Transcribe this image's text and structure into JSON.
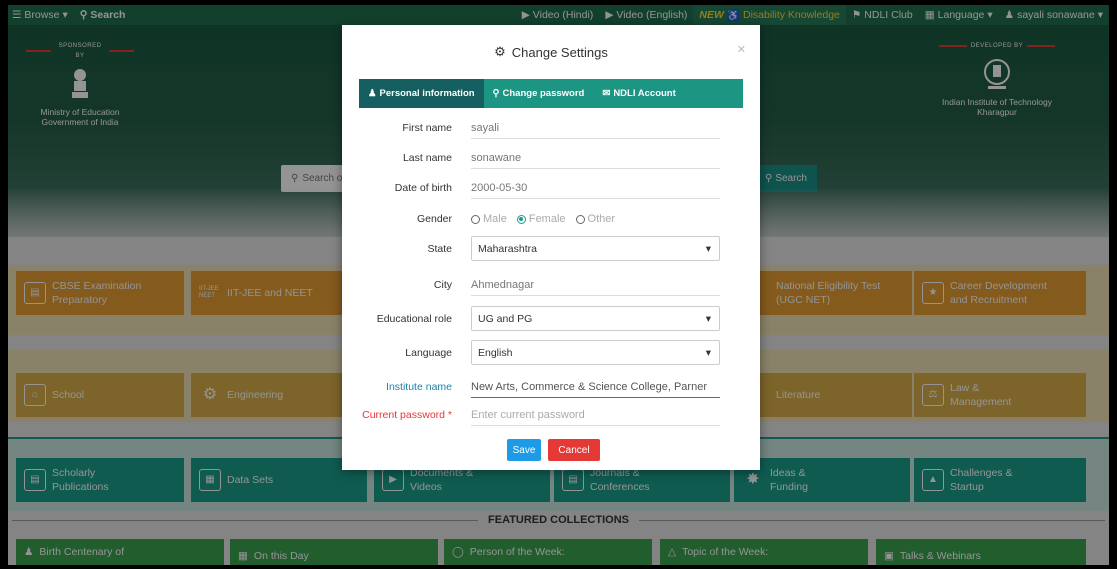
{
  "topbar": {
    "browse": "Browse",
    "search": "Search",
    "video_hindi": "Video (Hindi)",
    "video_english": "Video (English)",
    "new_badge": "NEW",
    "disability": "Disability Knowledge",
    "club": "NDLI Club",
    "language": "Language",
    "user": "sayali sonawane"
  },
  "hero": {
    "sponsor_caption": "SPONSORED BY",
    "sponsor_name": "Ministry of Education",
    "sponsor_sub": "Government of India",
    "developer_caption": "DEVELOPED BY",
    "developer_name": "Indian Institute of Technology",
    "developer_sub": "Kharagpur",
    "search_placeholder": "Search o",
    "search_button": "Search"
  },
  "tiles_row1": {
    "t1_line1": "CBSE Examination",
    "t1_line2": "Preparatory",
    "t2": "IIT-JEE and NEET",
    "t2_icon": "IIT-JEE NEET",
    "t3_line1": "National Eligibility Test",
    "t3_line2": "(UGC NET)",
    "t4_line1": "Career Development",
    "t4_line2": "and Recruitment"
  },
  "tiles_row2": {
    "t1": "School",
    "t2": "Engineering",
    "t3": "Literature",
    "t4_line1": "Law &",
    "t4_line2": "Management"
  },
  "tiles_row3": {
    "t1_line1": "Scholarly",
    "t1_line2": "Publications",
    "t2": "Data Sets",
    "t3_line1": "Documents &",
    "t3_line2": "Videos",
    "t4_line1": "Journals &",
    "t4_line2": "Conferences",
    "t5_line1": "Ideas &",
    "t5_line2": "Funding",
    "t6_line1": "Challenges &",
    "t6_line2": "Startup"
  },
  "featured": {
    "heading": "FEATURED COLLECTIONS",
    "c1": "Birth Centenary of",
    "c2": "On this Day",
    "c3": "Person of the Week:",
    "c4": "Topic of the Week:",
    "c5": "Talks & Webinars"
  },
  "modal": {
    "title": "Change Settings",
    "tabs": {
      "personal": "Personal information",
      "password": "Change password",
      "account": "NDLI Account"
    },
    "fields": {
      "first_name_label": "First name",
      "first_name": "sayali",
      "last_name_label": "Last name",
      "last_name": "sonawane",
      "dob_label": "Date of birth",
      "dob": "2000-05-30",
      "gender_label": "Gender",
      "gender_male": "Male",
      "gender_female": "Female",
      "gender_other": "Other",
      "state_label": "State",
      "state": "Maharashtra",
      "city_label": "City",
      "city": "Ahmednagar",
      "role_label": "Educational role",
      "role": "UG and PG",
      "language_label": "Language",
      "language": "English",
      "institute_label": "Institute name",
      "institute": "New Arts, Commerce & Science College, Parner",
      "current_password_label": "Current password *",
      "current_password_placeholder": "Enter current password"
    },
    "save": "Save",
    "cancel": "Cancel"
  },
  "colors": {
    "topbar": "#1f6f4e",
    "tab_bar": "#1d9583",
    "tab_active": "#155f60",
    "save": "#1e9be6",
    "cancel": "#e53935"
  }
}
